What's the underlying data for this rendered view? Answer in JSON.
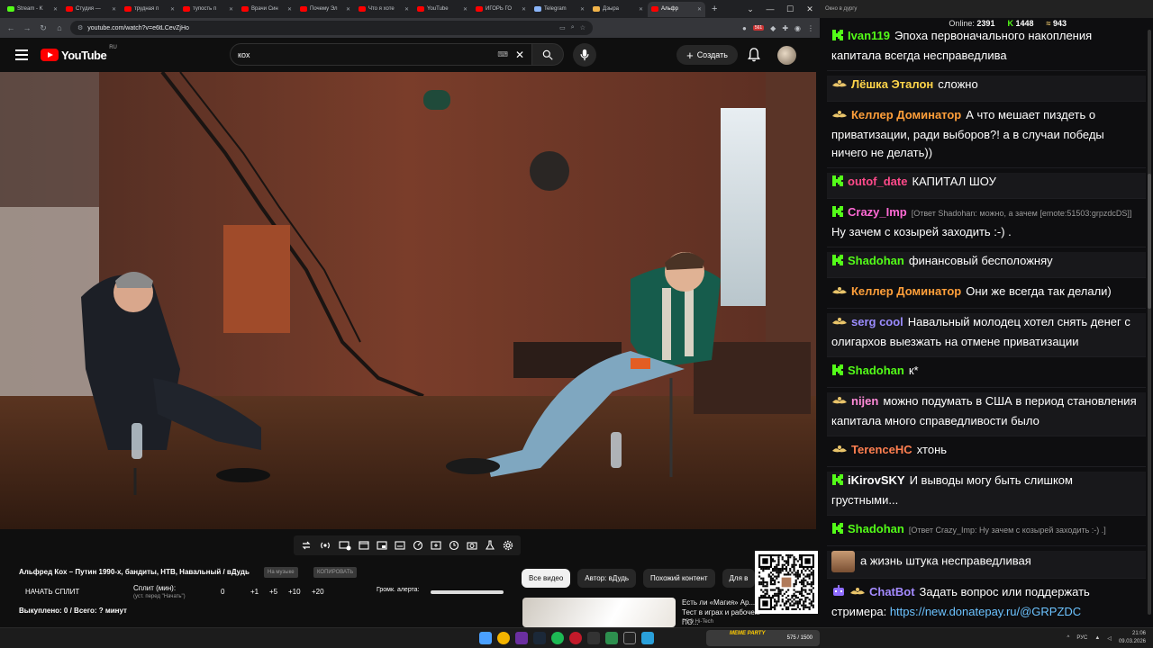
{
  "browser": {
    "tabs": [
      {
        "label": "Stream - K",
        "color": "#53fc18",
        "active": false
      },
      {
        "label": "Студия —",
        "color": "#ff0000",
        "active": false
      },
      {
        "label": "трудная п",
        "color": "#ff0000",
        "active": false
      },
      {
        "label": "тупость п",
        "color": "#ff0000",
        "active": false
      },
      {
        "label": "Врачи Син",
        "color": "#ff0000",
        "active": false
      },
      {
        "label": "Почему Эл",
        "color": "#ff0000",
        "active": false
      },
      {
        "label": "Что я хоте",
        "color": "#ff0000",
        "active": false
      },
      {
        "label": "YouTube",
        "color": "#ff0000",
        "active": false
      },
      {
        "label": "ИГОРЬ ГО",
        "color": "#ff0000",
        "active": false
      },
      {
        "label": "Telegram",
        "color": "#8ab4f8",
        "active": false
      },
      {
        "label": "Дзыра",
        "color": "#f1b34a",
        "active": false
      },
      {
        "label": "Альфр",
        "color": "#ff0000",
        "active": true
      }
    ],
    "url": "youtube.com/watch?v=e6tLCevZjHo",
    "ext_badge": "561"
  },
  "yt": {
    "logo": "YouTube",
    "country": "RU",
    "search_value": "кох",
    "create_label": "Создать"
  },
  "video": {
    "title": "Альфред Кох – Путин 1990-х, бандиты, НТВ, Навальный / вДудь",
    "pill_listen": "На музыке",
    "pill_copy": "КОПИРОВАТЬ"
  },
  "split": {
    "start_label": "НАЧАТЬ СПЛИТ",
    "minutes_label": "Сплит (мин):",
    "minutes_hint": "(уст. перед \"Начать\")",
    "minutes_value": "0",
    "steps": [
      "+1",
      "+5",
      "+10",
      "+20"
    ],
    "volume_label": "Громк. алерта:",
    "total": "Выкуплено: 0 / Всего: ? минут"
  },
  "chips": [
    "Все видео",
    "Автор: вДудь",
    "Похожий контент",
    "Для в"
  ],
  "rec": {
    "title": "Есть ли «Магия» Ар... Тест в играх и рабочем ПО...",
    "meta": "PRO Hi-Tech"
  },
  "chat": {
    "header": "Окно в дургу",
    "online_label": "Online:",
    "online": "2391",
    "kick_count": "1448",
    "other_count": "943",
    "messages": [
      {
        "badge": "kick",
        "user": "Ivan119",
        "color": "#53fc18",
        "text": "Эпоха первоначального накопления капитала всегда несправедлива"
      },
      {
        "badge": "twitch",
        "user": "Лёшка Эталон",
        "color": "#ffd54a",
        "text": "сложно"
      },
      {
        "badge": "twitch",
        "user": "Келлер Доминатор",
        "color": "#ff9f3a",
        "text": "А что мешает пиздеть о приватизации, ради выборов?! а в случаи победы ничего не делать))"
      },
      {
        "badge": "kick",
        "user": "outof_date",
        "color": "#ff4a8a",
        "text": "КАПИТАЛ ШОУ"
      },
      {
        "badge": "kick",
        "user": "Crazy_Imp",
        "color": "#ff6ad5",
        "reply": "[Ответ Shadohan: можно, а зачем [emote:51503:grpzdcDS]]",
        "text": "Ну зачем с козырей заходить :-) ."
      },
      {
        "badge": "kick",
        "user": "Shadohan",
        "color": "#53fc18",
        "text": "финансовый бесположняу"
      },
      {
        "badge": "twitch",
        "user": "Келлер Доминатор",
        "color": "#ff9f3a",
        "text": "Они же всегда так делали)"
      },
      {
        "badge": "twitch",
        "user": "serg cool",
        "color": "#9b8cff",
        "text": "Навальный молодец хотел снять денег с олигархов выезжать на отмене приватизации"
      },
      {
        "badge": "kick",
        "user": "Shadohan",
        "color": "#53fc18",
        "text": "к*"
      },
      {
        "badge": "twitch",
        "user": "nijen",
        "color": "#ff8ad8",
        "text": "можно подумать в США в период становления капитала много справедливости было"
      },
      {
        "badge": "twitch",
        "user": "TerenceHC",
        "color": "#ff7f50",
        "text": "хтонь"
      },
      {
        "badge": "kick",
        "user": "iKirovSKY",
        "color": "#ffffff",
        "text": "И выводы могу быть слишком грустными..."
      },
      {
        "badge": "kick",
        "user": "Shadohan",
        "color": "#53fc18",
        "reply": "[Ответ Crazy_Imp: Ну зачем с козырей заходить :-) .]",
        "text": ""
      },
      {
        "badge": "emote",
        "user": "",
        "color": "#ffffff",
        "text": "а жизнь штука несправедливая"
      },
      {
        "badge": "bot",
        "user": "ChatBot",
        "color": "#a48bff",
        "text": "Задать вопрос или поддержать стримера:",
        "link": "https://new.donatepay.ru/@GRPZDC"
      }
    ]
  },
  "taskbar": {
    "banner_label": "MEME PARTY",
    "banner_progress": "575 / 1500",
    "lang": "РУС",
    "time": "21:06",
    "date": "09.03.2026"
  }
}
